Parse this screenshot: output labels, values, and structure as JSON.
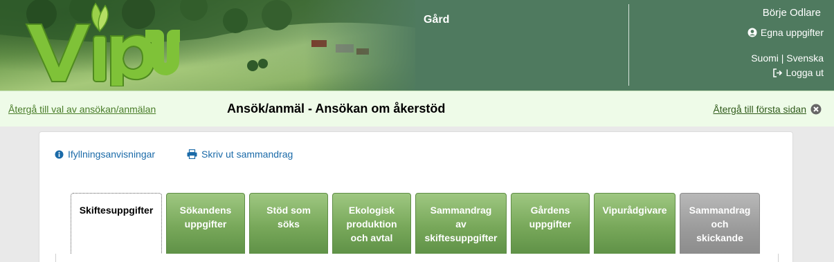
{
  "header": {
    "logo_text": "vipu",
    "farm_title": "Gård",
    "user_name": "Börje Odlare",
    "own_info_label": "Egna uppgifter",
    "language_text": "Suomi | Svenska",
    "logout_label": "Logga ut"
  },
  "subbar": {
    "back_link": "Återgå till val av ansökan/anmälan",
    "page_title": "Ansök/anmäl - Ansökan om åkerstöd",
    "home_link": "Återgå till första sidan"
  },
  "toolbar": {
    "instructions_label": "Ifyllningsanvisningar",
    "print_label": "Skriv ut sammandrag"
  },
  "tabs": [
    {
      "line1": "Skiftesuppgifter",
      "line2": "",
      "line3": ""
    },
    {
      "line1": "Sökandens",
      "line2": "uppgifter",
      "line3": ""
    },
    {
      "line1": "Stöd som",
      "line2": "söks",
      "line3": ""
    },
    {
      "line1": "Ekologisk",
      "line2": "produktion",
      "line3": "och avtal"
    },
    {
      "line1": "Sammandrag",
      "line2": "av",
      "line3": "skiftesuppgifter"
    },
    {
      "line1": "Gårdens",
      "line2": "uppgifter",
      "line3": ""
    },
    {
      "line1": "Vipurådgivare",
      "line2": "",
      "line3": ""
    },
    {
      "line1": "Sammandrag",
      "line2": "och",
      "line3": "skickande"
    }
  ],
  "colors": {
    "header_bg": "#4f7a5f",
    "subbar_bg": "#eefbe8",
    "tab_green": "#78a85a",
    "tab_gray": "#9a9a9a",
    "link_blue": "#1a6aa8"
  }
}
